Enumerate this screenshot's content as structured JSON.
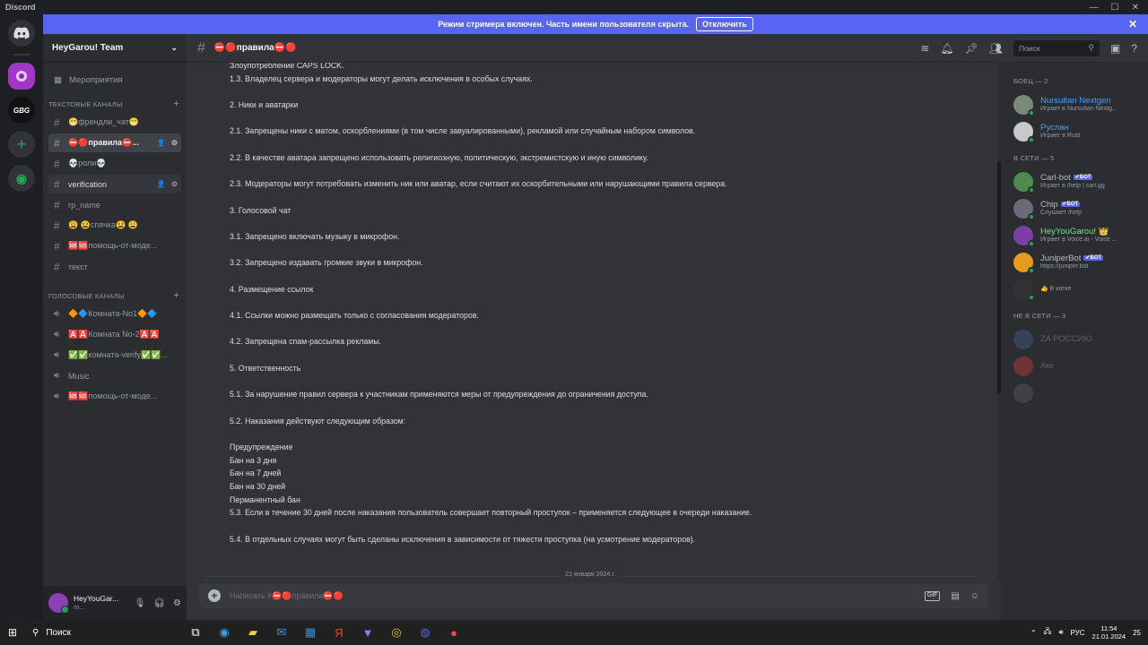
{
  "window": {
    "title": "Discord"
  },
  "guilds": [
    {
      "label": "",
      "icon": "discord-logo-icon"
    },
    {
      "label": "",
      "icon": "heygarou-server-icon"
    },
    {
      "label": "GBG",
      "icon": "gbg-server-icon"
    },
    {
      "label": "+",
      "icon": "add-server-icon"
    },
    {
      "label": "◉",
      "icon": "explore-icon"
    }
  ],
  "banner": {
    "text": "Режим стримера включен. Часть имени пользователя скрыта.",
    "button": "Отключить",
    "close": "✕"
  },
  "server": {
    "name": "HeyGarou! Team",
    "chevron": "⌄"
  },
  "events": {
    "label": "Мероприятия"
  },
  "text_category": {
    "label": "ТЕКСТОВЫЕ КАНАЛЫ",
    "plus": "+"
  },
  "text_channels": [
    {
      "label": "😁френдли_чат😁"
    },
    {
      "label": "⛔🔴правила⛔..."
    },
    {
      "label": "💀роли💀"
    },
    {
      "label": "verification"
    },
    {
      "label": "гр_name"
    },
    {
      "label": "😩 😫спячка😫 😩"
    },
    {
      "label": "🆘🆘помощь-от-моде..."
    },
    {
      "label": "текст"
    }
  ],
  "voice_category": {
    "label": "ГОЛОСОВЫЕ КАНАЛЫ",
    "plus": "+"
  },
  "voice_channels": [
    {
      "label": "🔶🔷Комната-No1🔶🔷"
    },
    {
      "label": "🅰️🅰️Комната No-2🅰️🅰️"
    },
    {
      "label": "✅✅комната-verify✅✅..."
    },
    {
      "label": "Music"
    },
    {
      "label": "🆘🆘помощь-от-моде..."
    }
  ],
  "user": {
    "name": "HeyYouGar...",
    "sub": "m..."
  },
  "channel": {
    "name": "⛔🔴правила⛔🔴"
  },
  "search": {
    "placeholder": "Поиск"
  },
  "messages": [
    "Злоупотребление CAPS LOCK.",
    "1.3. Владелец сервера и модераторы могут делать исключения в особых случаях.",
    "",
    "2. Ники и аватарки",
    "",
    "2.1. Запрещены ники с матом, оскорблениями (в том числе завуалированными), рекламой или случайным набором символов.",
    "",
    "2.2. В качестве аватара запрещено использовать религиозную, политическую, экстремистскую и иную символику.",
    "",
    "2.3. Модераторы могут потребовать изменить ник или аватар, если считают их оскорбительными или нарушающими правила сервера.",
    "",
    "3. Голосовой чат",
    "",
    "3.1. Запрещено включать музыку в микрофон.",
    "",
    "3.2. Запрещено издавать громкие звуки в микрофон.",
    "",
    "4. Размещение ссылок",
    "",
    "4.1. Ссылки можно размещать только с согласования модераторов.",
    "",
    "4.2. Запрещена спам-рассылка рекламы.",
    "",
    "5. Ответственность",
    "",
    "5.1. За нарушение правил сервера к участникам применяются меры от предупреждения до ограничения доступа.",
    "",
    "5.2. Наказания действуют следующим образом:",
    "",
    "Предупреждение",
    "Бан на 3 дня",
    "Бан на 7 дней",
    "Бан на 30 дней",
    "Перманентный бан",
    "5.3. Если в течение 30 дней после наказания пользователь совершает повторный проступок – применяется следующее в очереди наказание.",
    "",
    "5.4. В отдельных случаях могут быть сделаны исключения в зависимости от тяжести проступка (на усмотрение модераторов)."
  ],
  "date_divider": "21 января 2024 г.",
  "composer": {
    "placeholder": "Написать #⛔🔴правила⛔🔴",
    "gif": "GIF"
  },
  "member_sections": [
    {
      "title": "БОЕЦ — 2",
      "members": [
        {
          "name": "Nursultan Nextgen",
          "activity": "Играет в Nursultan Nextg...",
          "color": "#4f9cf9",
          "bot": "",
          "avatar": "#7a8a7a",
          "status": "#23a559"
        },
        {
          "name": "Руслан",
          "activity": "Играет в Rust",
          "color": "#4f9cf9",
          "bot": "",
          "avatar": "#c9c9c9",
          "status": "#23a559"
        }
      ]
    },
    {
      "title": "В СЕТИ — 5",
      "members": [
        {
          "name": "Carl-bot",
          "activity": "Играет в /help | carl.gg",
          "color": "#b5bac1",
          "bot": "✔БОТ",
          "avatar": "#4e8a4e",
          "status": "#23a559"
        },
        {
          "name": "Chip",
          "activity": "Слушает /help",
          "color": "#b5bac1",
          "bot": "✔БОТ",
          "avatar": "#6a6a7a",
          "status": "#23a559"
        },
        {
          "name": "HeyYouGarou! 👑",
          "activity": "Играет в Voice.ai - Voice ...",
          "color": "#57f287",
          "bot": "",
          "avatar": "#7b3fa6",
          "status": "#23a559"
        },
        {
          "name": "JuniperBot",
          "activity": "https://juniper.bot",
          "color": "#b5bac1",
          "bot": "✔БОТ",
          "avatar": "#e69a1e",
          "status": "#23a559"
        },
        {
          "name": "",
          "activity": "👍 В катке",
          "color": "#2e6b38",
          "bot": "",
          "avatar": "#333333",
          "status": "#23a559"
        }
      ]
    },
    {
      "title": "НЕ В СЕТИ — 3",
      "members": [
        {
          "name": "ZA РОССИЮ",
          "activity": "",
          "color": "#b5bac1",
          "bot": "",
          "avatar": "#4a6aa0",
          "status": ""
        },
        {
          "name": "Акк",
          "activity": "",
          "color": "#b5bac1",
          "bot": "",
          "avatar": "#ed4245",
          "status": ""
        },
        {
          "name": "",
          "activity": "",
          "color": "#b5bac1",
          "bot": "",
          "avatar": "#666666",
          "status": ""
        }
      ]
    }
  ],
  "taskbar": {
    "search": "Поиск",
    "lang": "РУС",
    "time": "11:54",
    "date": "21.01.2024",
    "badge": "25"
  }
}
